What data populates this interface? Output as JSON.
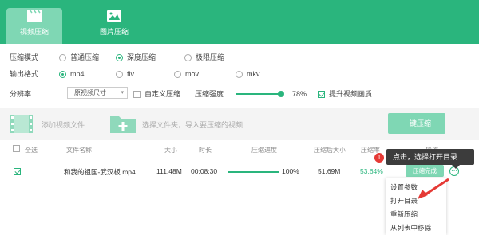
{
  "tabs": [
    {
      "label": "视频压缩",
      "icon": "video-clapper-icon",
      "active": true
    },
    {
      "label": "图片压缩",
      "icon": "image-icon",
      "active": false
    }
  ],
  "settings": {
    "mode": {
      "label": "压缩模式",
      "options": [
        "普通压缩",
        "深度压缩",
        "极限压缩"
      ],
      "selected": "深度压缩"
    },
    "format": {
      "label": "输出格式",
      "options": [
        "mp4",
        "flv",
        "mov",
        "mkv"
      ],
      "selected": "mp4"
    },
    "resolution": {
      "label": "分辨率",
      "value": "原视频尺寸"
    },
    "custom_compress": {
      "label": "自定义压缩",
      "checked": false
    },
    "strength": {
      "label": "压缩强度",
      "value": "78%",
      "fraction": 0.78
    },
    "quality": {
      "label": "提升视频画质",
      "checked": true
    }
  },
  "add_bar": {
    "add_video": "添加视频文件",
    "choose_folder": "选择文件夹，导入要压缩的视频",
    "compress_button": "一键压缩"
  },
  "table": {
    "headers": [
      "全选",
      "文件名称",
      "大小",
      "时长",
      "压缩进度",
      "压缩后大小",
      "压缩率",
      "操作"
    ],
    "rows": [
      {
        "checked": true,
        "name": "和我的祖国-武汉板.mp4",
        "size": "111.48M",
        "duration": "00:08:30",
        "progress": "100%",
        "progress_fraction": 1.0,
        "after": "51.69M",
        "ratio": "53.64%",
        "status": "压缩完成"
      }
    ]
  },
  "tooltip": {
    "badge": "1",
    "text": "点击，选择打开目录"
  },
  "menu": [
    "设置参数",
    "打开目录",
    "重新压缩",
    "从列表中移除"
  ],
  "colors": {
    "accent": "#2ab57d",
    "accent_light": "#7fd7b4",
    "badge": "#e53935",
    "arrow": "#e53935"
  }
}
